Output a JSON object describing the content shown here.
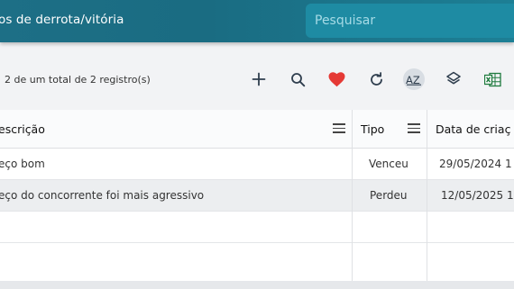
{
  "header": {
    "title": "os de derrota/vitória",
    "search_placeholder": "Pesquisar"
  },
  "toolbar": {
    "record_count": "2 de um total de 2 registro(s)",
    "tools": [
      {
        "name": "add-icon",
        "color": "#2f3e4e"
      },
      {
        "name": "search-icon",
        "color": "#2f3e4e"
      },
      {
        "name": "heart-icon",
        "color": "#e53935"
      },
      {
        "name": "refresh-icon",
        "color": "#2f3e4e"
      },
      {
        "name": "sort-az-icon",
        "color": "#2f3e4e",
        "text": "AZ"
      },
      {
        "name": "layers-icon",
        "color": "#2f3e4e"
      },
      {
        "name": "excel-icon",
        "color": "#1f7a3e"
      }
    ]
  },
  "table": {
    "columns": [
      "escrição",
      "Tipo",
      "Data de criaç"
    ],
    "rows": [
      {
        "descricao": "eço bom",
        "tipo": "Venceu",
        "data": "29/05/2024 1"
      },
      {
        "descricao": "eço do concorrente foi mais agressivo",
        "tipo": "Perdeu",
        "data": "12/05/2025 1("
      }
    ]
  }
}
